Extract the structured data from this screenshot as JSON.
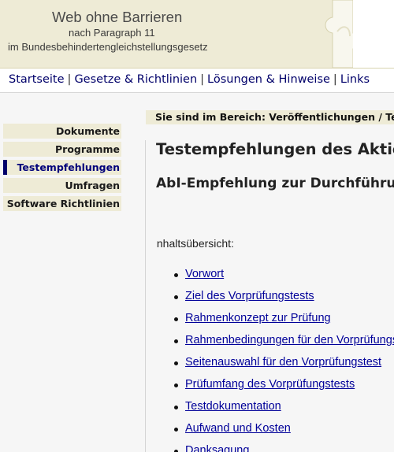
{
  "header": {
    "title": "Web ohne Barrieren",
    "subtitle_line1": "nach Paragraph 11",
    "subtitle_line2": "im Bundesbehindertengleichstellungsgesetz"
  },
  "topnav": {
    "items": [
      {
        "label": "Startseite"
      },
      {
        "label": "Gesetze & Richtlinien"
      },
      {
        "label": "Lösungen & Hinweise"
      },
      {
        "label": "Links"
      }
    ],
    "separator": "|"
  },
  "breadcrumb": "Sie sind im Bereich: Veröffentlichungen / Testempfehlungen",
  "sidebar": {
    "items": [
      {
        "label": "Dokumente",
        "active": false
      },
      {
        "label": "Programme",
        "active": false
      },
      {
        "label": "Testempfehlungen",
        "active": true
      },
      {
        "label": "Umfragen",
        "active": false
      },
      {
        "label": "Software Richtlinien",
        "active": false
      }
    ]
  },
  "main": {
    "heading": "Testempfehlungen des Aktionsbündnisses",
    "subheading": "AbI-Empfehlung zur Durchführung von Vorprüfungstests",
    "toc_label": "Inhaltsübersicht:",
    "toc": [
      "Vorwort",
      "Ziel des Vorprüfungstests",
      "Rahmenkonzept zur Prüfung",
      "Rahmenbedingungen für den Vorprüfungstest",
      "Seitenauswahl für den Vorprüfungstest",
      "Prüfumfang des Vorprüfungstests",
      "Testdokumentation",
      "Aufwand und Kosten",
      "Danksagung"
    ]
  },
  "colors": {
    "banner": "#eeebd6",
    "nav_link": "#00006a",
    "toc_link": "#000099",
    "body_bg": "#f6f6f6"
  }
}
